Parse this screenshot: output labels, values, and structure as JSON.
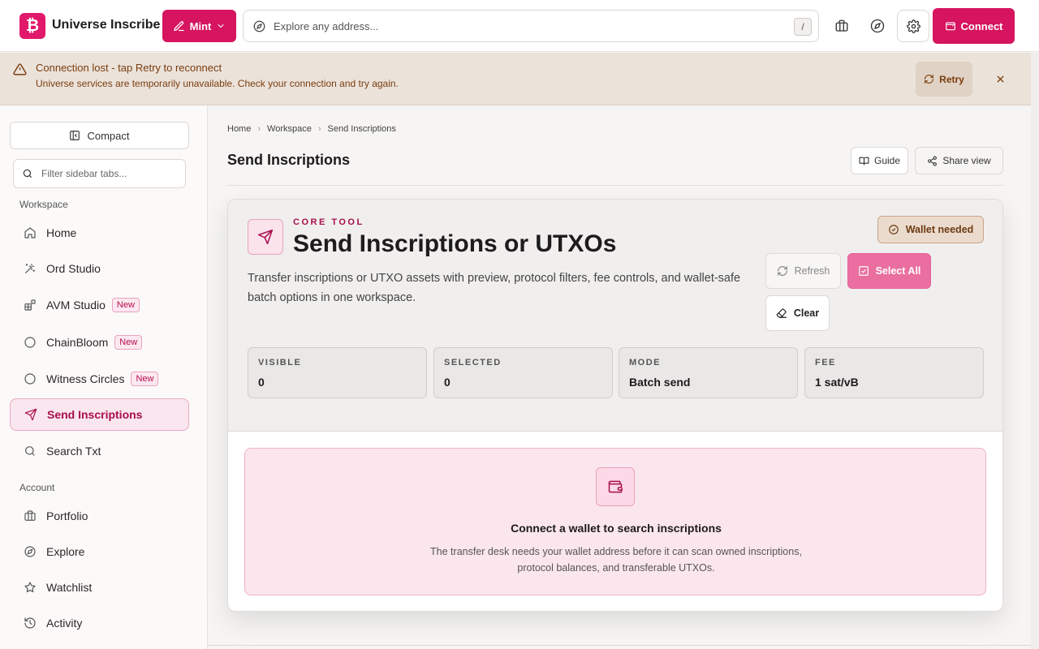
{
  "header": {
    "logo_glyph": "₿",
    "app_title": "Universe Inscribe",
    "mint_label": "Mint",
    "search_placeholder": "Explore any address...",
    "search_shortcut": "/",
    "connect_label": "Connect"
  },
  "banner": {
    "title": "Connection lost - tap Retry to reconnect",
    "text": "Universe services are temporarily unavailable. Check your connection and try again.",
    "retry_label": "Retry"
  },
  "sidebar": {
    "compact_label": "Compact",
    "filter_placeholder": "Filter sidebar tabs...",
    "workspace_label": "Workspace",
    "account_label": "Account",
    "items": [
      {
        "label": "Home"
      },
      {
        "label": "Ord Studio"
      },
      {
        "label": "AVM Studio",
        "badge": "New"
      },
      {
        "label": "ChainBloom",
        "badge": "New"
      },
      {
        "label": "Witness Circles",
        "badge": "New"
      },
      {
        "label": "Send Inscriptions"
      },
      {
        "label": "Search Txt"
      },
      {
        "label": "Portfolio"
      },
      {
        "label": "Explore"
      },
      {
        "label": "Watchlist"
      },
      {
        "label": "Activity"
      }
    ]
  },
  "breadcrumb": [
    "Home",
    "Workspace",
    "Send Inscriptions"
  ],
  "page": {
    "title": "Send Inscriptions",
    "guide_label": "Guide",
    "share_label": "Share view"
  },
  "tool": {
    "eyebrow": "CORE TOOL",
    "title": "Send Inscriptions or UTXOs",
    "description": "Transfer inscriptions or UTXO assets with preview, protocol filters, fee controls, and wallet-safe batch options in one workspace.",
    "wallet_badge": "Wallet needed",
    "refresh_label": "Refresh",
    "select_all_label": "Select All",
    "clear_label": "Clear",
    "stats": [
      {
        "label": "VISIBLE",
        "value": "0"
      },
      {
        "label": "SELECTED",
        "value": "0"
      },
      {
        "label": "MODE",
        "value": "Batch send"
      },
      {
        "label": "FEE",
        "value": "1 sat/vB"
      }
    ]
  },
  "empty_state": {
    "title": "Connect a wallet to search inscriptions",
    "text": "The transfer desk needs your wallet address before it can scan owned inscriptions, protocol balances, and transferable UTXOs."
  },
  "colors": {
    "brand": "#d6145f",
    "brand_light": "#fbe6ed",
    "warning_bg": "#ebe2da",
    "warning_text": "#7a3d0e"
  },
  "icons": {
    "nav": [
      "home-icon",
      "wand-icon",
      "blocks-icon",
      "circle-icon",
      "circle-icon",
      "send-icon",
      "search-icon",
      "briefcase-icon",
      "compass-icon",
      "star-icon",
      "history-icon"
    ]
  }
}
